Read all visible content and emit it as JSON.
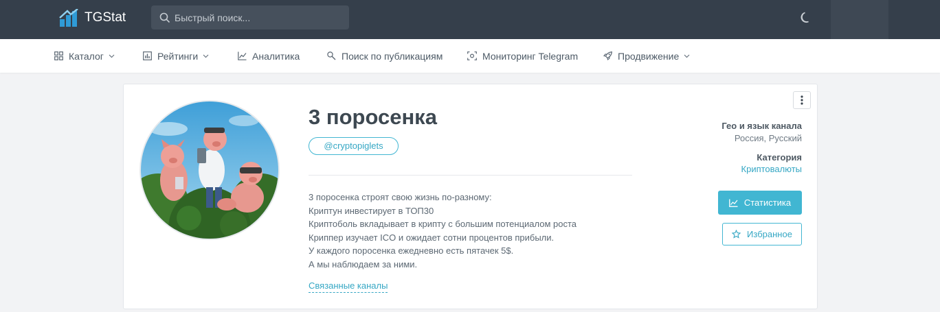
{
  "header": {
    "logo_text": "TGStat",
    "search_placeholder": "Быстрый поиск..."
  },
  "nav": {
    "items": [
      {
        "label": "Каталог",
        "icon": "grid-icon",
        "dropdown": true
      },
      {
        "label": "Рейтинги",
        "icon": "bar-chart-icon",
        "dropdown": true
      },
      {
        "label": "Аналитика",
        "icon": "line-chart-icon",
        "dropdown": false
      },
      {
        "label": "Поиск по публикациям",
        "icon": "key-search-icon",
        "dropdown": false
      },
      {
        "label": "Мониторинг Telegram",
        "icon": "monitor-icon",
        "dropdown": false
      },
      {
        "label": "Продвижение",
        "icon": "rocket-icon",
        "dropdown": true
      }
    ]
  },
  "channel": {
    "title": "3 поросенка",
    "handle": "@cryptopiglets",
    "description": [
      "3 поросенка строят свою жизнь по-разному:",
      "Криптун инвестирует в ТОП30",
      "Криптоболь вкладывает в крипту с большим потенциалом роста",
      "Криппер изучает ICO и ожидает сотни процентов прибыли.",
      "У каждого поросенка ежедневно есть пятачек 5$.",
      "А мы наблюдаем за ними."
    ],
    "related_link": "Связанные каналы",
    "geo_label": "Гео и язык канала",
    "geo_value": "Россия, Русский",
    "category_label": "Категория",
    "category_value": "Криптовалюты",
    "stats_button": "Статистика",
    "favorite_button": "Избранное"
  },
  "colors": {
    "topbar": "#353f4b",
    "accent": "#41b6d2",
    "logo_blue": "#2f9bd6"
  }
}
